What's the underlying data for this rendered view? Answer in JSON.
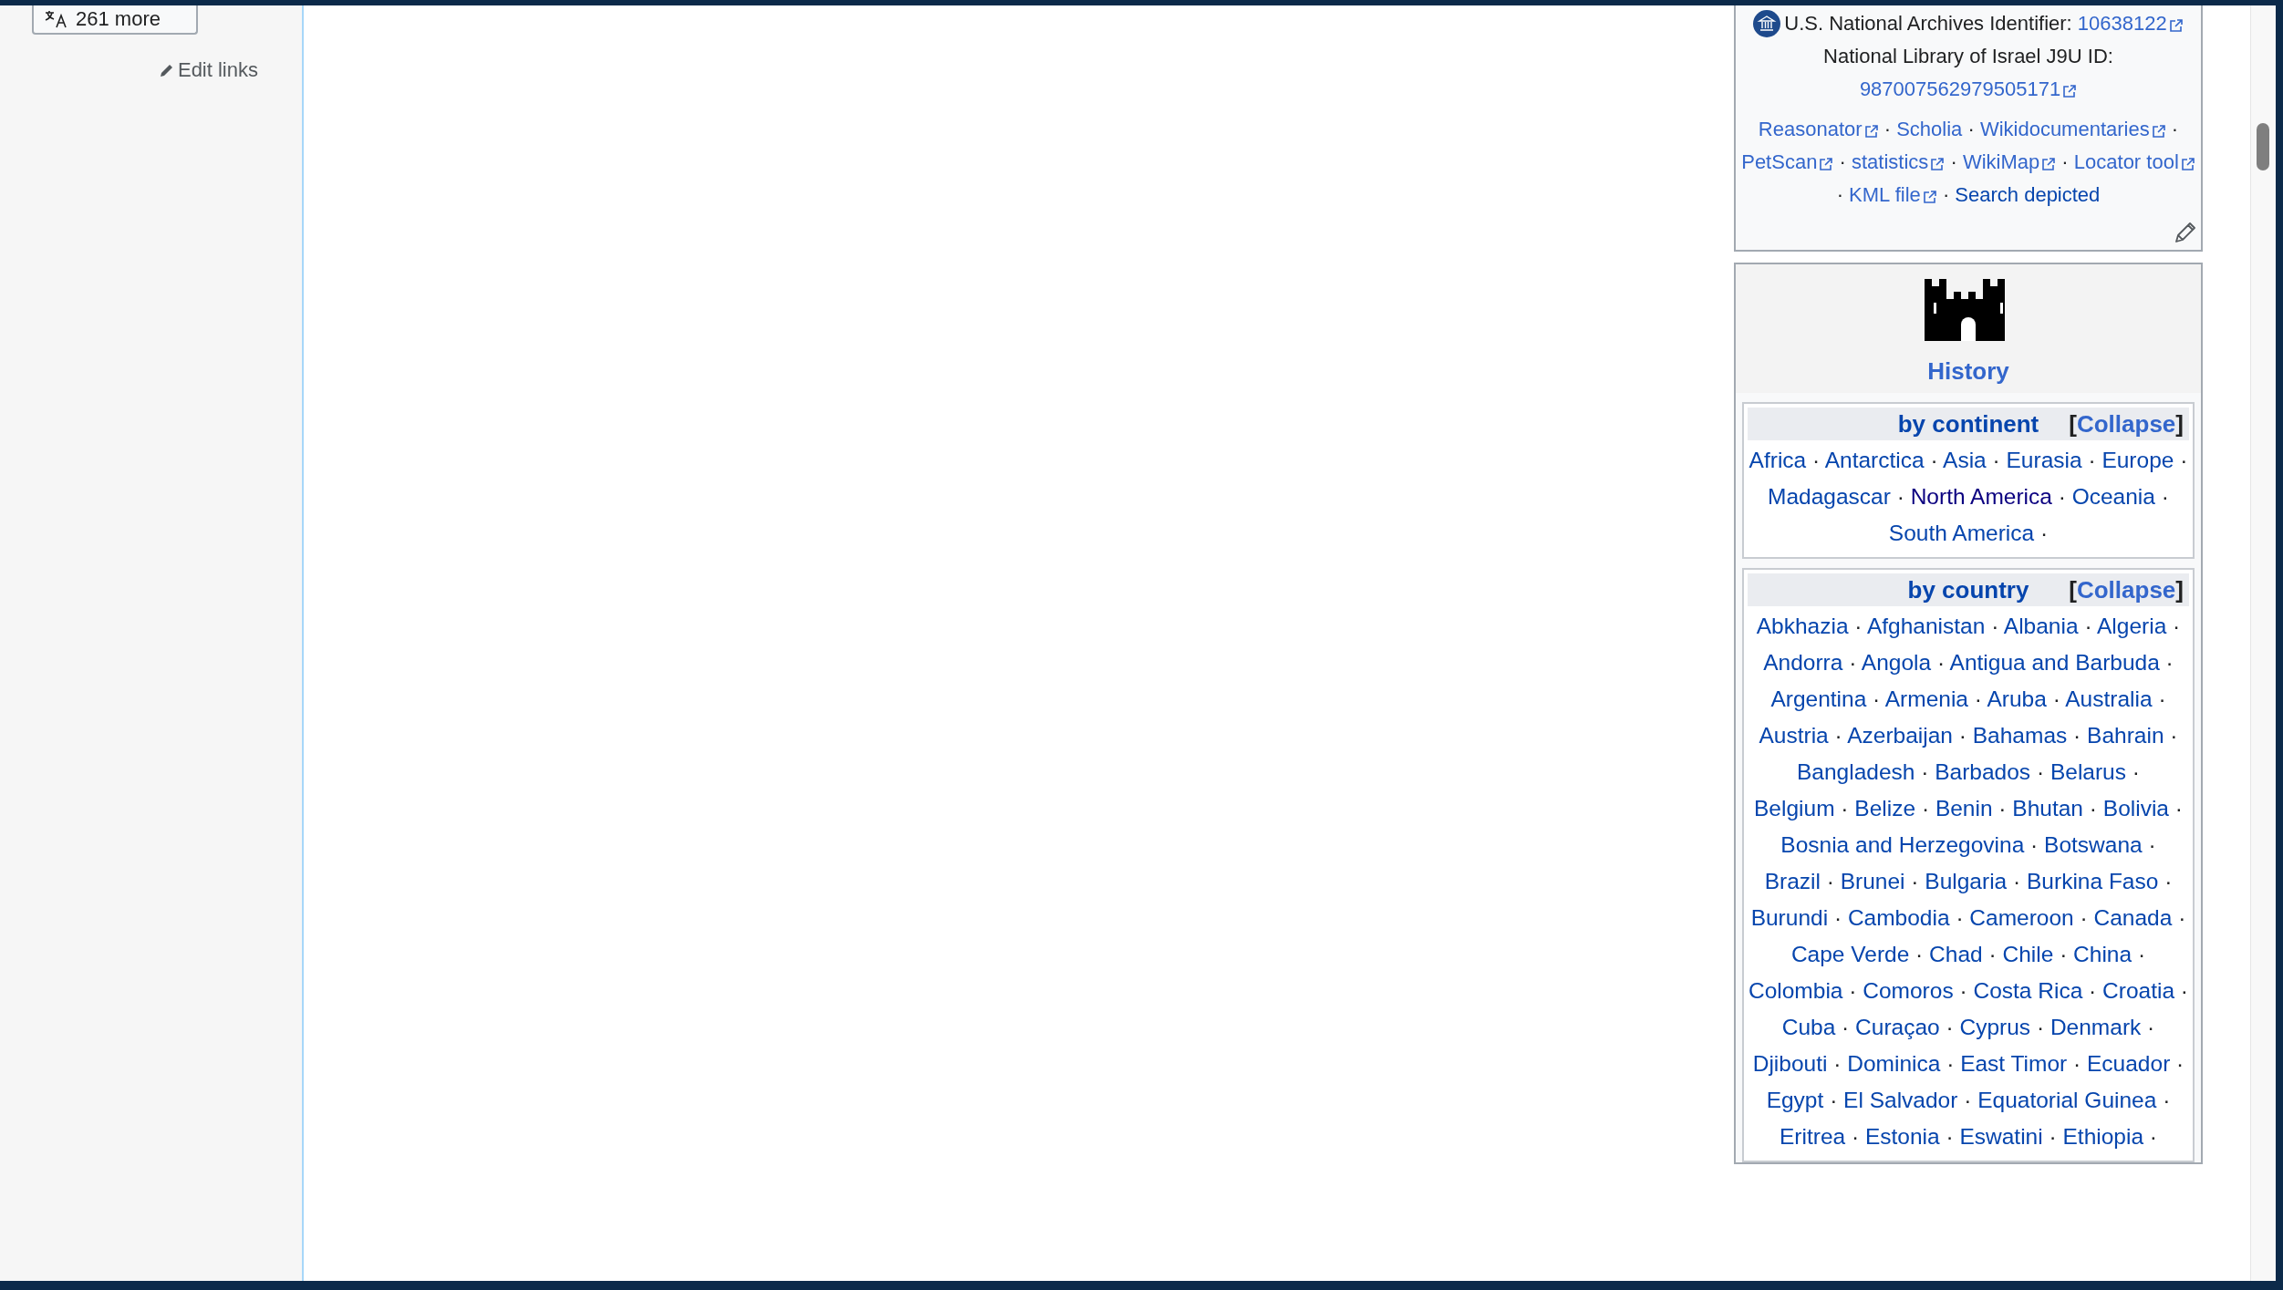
{
  "sidebar": {
    "languages_button": {
      "label": "261 more"
    },
    "edit_links": "Edit links"
  },
  "authority_box": {
    "rows": [
      {
        "kind": "with-icon",
        "label": "U.S. National Archives Identifier:",
        "id": "10638122"
      },
      {
        "kind": "plain",
        "label": "National Library of Israel J9U ID:",
        "id": "987007562979505171"
      }
    ],
    "separator": "·",
    "tools": [
      {
        "label": "Reasonator",
        "kind": "external"
      },
      {
        "label": "Scholia",
        "kind": "plain"
      },
      {
        "label": "Wikidocumentaries",
        "kind": "external"
      },
      {
        "label": "PetScan",
        "kind": "external"
      },
      {
        "label": "statistics",
        "kind": "external"
      },
      {
        "label": "WikiMap",
        "kind": "external"
      },
      {
        "label": "Locator tool",
        "kind": "external"
      },
      {
        "label": "KML file",
        "kind": "external"
      },
      {
        "label": "Search depicted",
        "kind": "local"
      }
    ]
  },
  "history": {
    "title": "History",
    "groups": [
      {
        "title": "by continent",
        "toggle": {
          "open": "[",
          "label": "Collapse",
          "close": "]"
        },
        "separator": "·",
        "items": [
          {
            "label": "Africa",
            "visited": false
          },
          {
            "label": "Antarctica",
            "visited": false
          },
          {
            "label": "Asia",
            "visited": false
          },
          {
            "label": "Eurasia",
            "visited": false
          },
          {
            "label": "Europe",
            "visited": false
          },
          {
            "label": "Madagascar",
            "visited": false
          },
          {
            "label": "North America",
            "visited": true
          },
          {
            "label": "Oceania",
            "visited": false
          },
          {
            "label": "South America",
            "visited": false
          }
        ]
      },
      {
        "title": "by country",
        "toggle": {
          "open": "[",
          "label": "Collapse",
          "close": "]"
        },
        "separator": "·",
        "items": [
          {
            "label": "Abkhazia",
            "visited": false
          },
          {
            "label": "Afghanistan",
            "visited": false
          },
          {
            "label": "Albania",
            "visited": false
          },
          {
            "label": "Algeria",
            "visited": false
          },
          {
            "label": "Andorra",
            "visited": false
          },
          {
            "label": "Angola",
            "visited": false
          },
          {
            "label": "Antigua and Barbuda",
            "visited": false
          },
          {
            "label": "Argentina",
            "visited": false
          },
          {
            "label": "Armenia",
            "visited": false
          },
          {
            "label": "Aruba",
            "visited": false
          },
          {
            "label": "Australia",
            "visited": false
          },
          {
            "label": "Austria",
            "visited": false
          },
          {
            "label": "Azerbaijan",
            "visited": false
          },
          {
            "label": "Bahamas",
            "visited": false
          },
          {
            "label": "Bahrain",
            "visited": false
          },
          {
            "label": "Bangladesh",
            "visited": false
          },
          {
            "label": "Barbados",
            "visited": false
          },
          {
            "label": "Belarus",
            "visited": false
          },
          {
            "label": "Belgium",
            "visited": false
          },
          {
            "label": "Belize",
            "visited": false
          },
          {
            "label": "Benin",
            "visited": false
          },
          {
            "label": "Bhutan",
            "visited": false
          },
          {
            "label": "Bolivia",
            "visited": false
          },
          {
            "label": "Bosnia and Herzegovina",
            "visited": false
          },
          {
            "label": "Botswana",
            "visited": false
          },
          {
            "label": "Brazil",
            "visited": false
          },
          {
            "label": "Brunei",
            "visited": false
          },
          {
            "label": "Bulgaria",
            "visited": false
          },
          {
            "label": "Burkina Faso",
            "visited": false
          },
          {
            "label": "Burundi",
            "visited": false
          },
          {
            "label": "Cambodia",
            "visited": false
          },
          {
            "label": "Cameroon",
            "visited": false
          },
          {
            "label": "Canada",
            "visited": false
          },
          {
            "label": "Cape Verde",
            "visited": false
          },
          {
            "label": "Chad",
            "visited": false
          },
          {
            "label": "Chile",
            "visited": false
          },
          {
            "label": "China",
            "visited": false
          },
          {
            "label": "Colombia",
            "visited": false
          },
          {
            "label": "Comoros",
            "visited": false
          },
          {
            "label": "Costa Rica",
            "visited": false
          },
          {
            "label": "Croatia",
            "visited": false
          },
          {
            "label": "Cuba",
            "visited": false
          },
          {
            "label": "Curaçao",
            "visited": false
          },
          {
            "label": "Cyprus",
            "visited": false
          },
          {
            "label": "Denmark",
            "visited": false
          },
          {
            "label": "Djibouti",
            "visited": false
          },
          {
            "label": "Dominica",
            "visited": false
          },
          {
            "label": "East Timor",
            "visited": false
          },
          {
            "label": "Ecuador",
            "visited": false
          },
          {
            "label": "Egypt",
            "visited": false
          },
          {
            "label": "El Salvador",
            "visited": false
          },
          {
            "label": "Equatorial Guinea",
            "visited": false
          },
          {
            "label": "Eritrea",
            "visited": false
          },
          {
            "label": "Estonia",
            "visited": false
          },
          {
            "label": "Eswatini",
            "visited": false
          },
          {
            "label": "Ethiopia",
            "visited": false
          }
        ]
      }
    ]
  }
}
